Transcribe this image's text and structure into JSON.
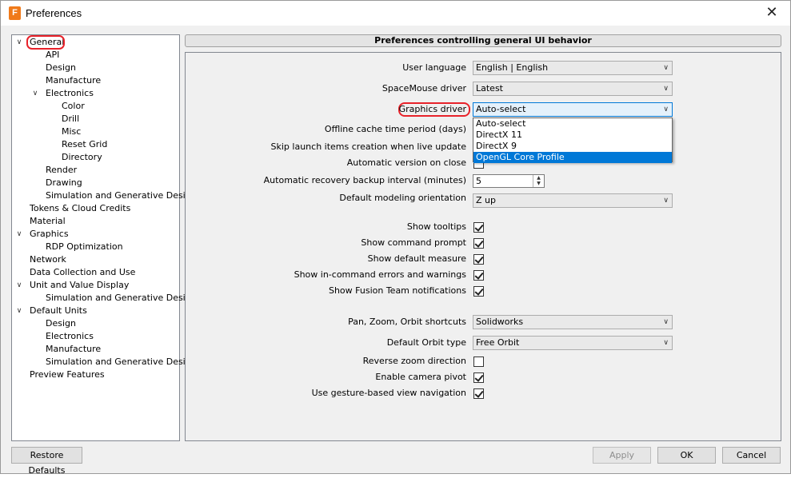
{
  "window": {
    "title": "Preferences",
    "icon_letter": "F",
    "close_label": "✕"
  },
  "tree": {
    "items": [
      {
        "label": "General",
        "expanded": true,
        "selected": true
      },
      {
        "label": "API"
      },
      {
        "label": "Design"
      },
      {
        "label": "Manufacture"
      },
      {
        "label": "Electronics",
        "expanded": true
      },
      {
        "label": "Color"
      },
      {
        "label": "Drill"
      },
      {
        "label": "Misc"
      },
      {
        "label": "Reset Grid"
      },
      {
        "label": "Directory"
      },
      {
        "label": "Render"
      },
      {
        "label": "Drawing"
      },
      {
        "label": "Simulation and Generative Design"
      },
      {
        "label": "Tokens & Cloud Credits"
      },
      {
        "label": "Material"
      },
      {
        "label": "Graphics",
        "expanded": true
      },
      {
        "label": "RDP Optimization"
      },
      {
        "label": "Network"
      },
      {
        "label": "Data Collection and Use"
      },
      {
        "label": "Unit and Value Display",
        "expanded": true
      },
      {
        "label": "Simulation and Generative Design"
      },
      {
        "label": "Default Units",
        "expanded": true
      },
      {
        "label": "Design"
      },
      {
        "label": "Electronics"
      },
      {
        "label": "Manufacture"
      },
      {
        "label": "Simulation and Generative Design"
      },
      {
        "label": "Preview Features"
      }
    ]
  },
  "panel": {
    "header": "Preferences controlling general UI behavior",
    "user_language": {
      "label": "User language",
      "value": "English | English"
    },
    "spacemouse": {
      "label": "SpaceMouse driver",
      "value": "Latest"
    },
    "graphics_driver": {
      "label": "Graphics driver",
      "value": "Auto-select",
      "options": [
        "Auto-select",
        "DirectX 11",
        "DirectX 9",
        "OpenGL Core Profile"
      ],
      "highlighted_option": "OpenGL Core Profile"
    },
    "offline_cache": {
      "label": "Offline cache time period (days)"
    },
    "skip_launch": {
      "label": "Skip launch items creation when live update"
    },
    "auto_version": {
      "label": "Automatic version on close",
      "checked": false
    },
    "recovery_interval": {
      "label": "Automatic recovery backup interval (minutes)",
      "value": "5"
    },
    "default_orientation": {
      "label": "Default modeling orientation",
      "value": "Z up"
    },
    "show_tooltips": {
      "label": "Show tooltips",
      "checked": true
    },
    "show_command_prompt": {
      "label": "Show command prompt",
      "checked": true
    },
    "show_default_measure": {
      "label": "Show default measure",
      "checked": true
    },
    "show_in_command_errors": {
      "label": "Show in-command errors and warnings",
      "checked": true
    },
    "show_fusion_team": {
      "label": "Show Fusion Team notifications",
      "checked": true
    },
    "pan_zoom_orbit": {
      "label": "Pan, Zoom, Orbit shortcuts",
      "value": "Solidworks"
    },
    "default_orbit": {
      "label": "Default Orbit type",
      "value": "Free Orbit"
    },
    "reverse_zoom": {
      "label": "Reverse zoom direction",
      "checked": false
    },
    "camera_pivot": {
      "label": "Enable camera pivot",
      "checked": true
    },
    "gesture_nav": {
      "label": "Use gesture-based view navigation",
      "checked": true
    }
  },
  "buttons": {
    "restore_defaults": "Restore Defaults",
    "apply": "Apply",
    "ok": "OK",
    "cancel": "Cancel"
  },
  "colors": {
    "accent": "#0078d7",
    "annotation_red": "#e8222a",
    "app_icon": "#f07a1a"
  }
}
